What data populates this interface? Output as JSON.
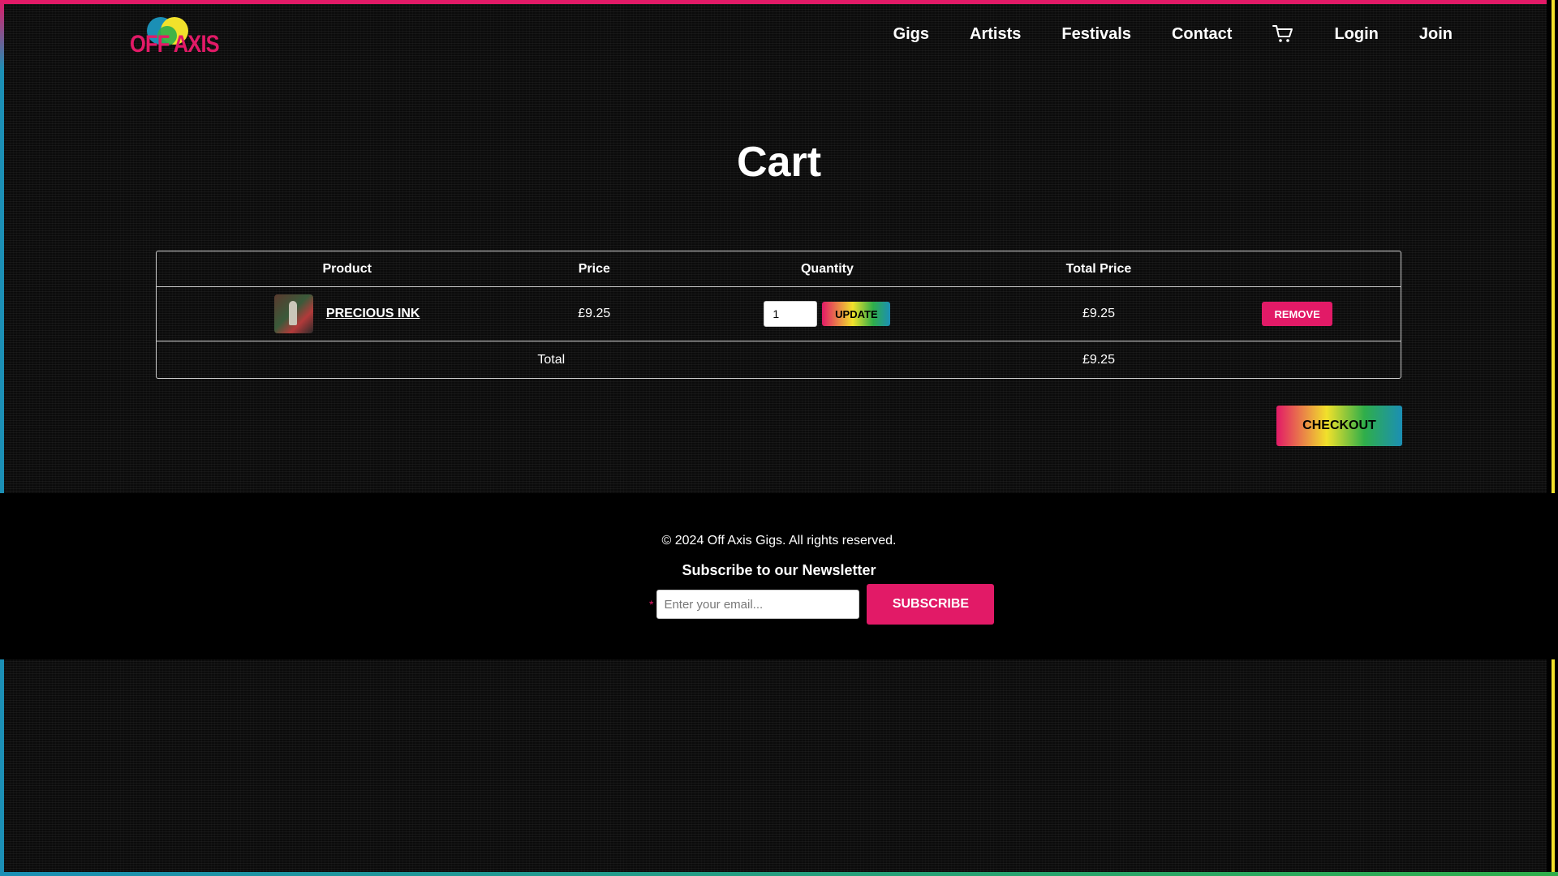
{
  "brand": {
    "logo_text": "OFF AXIS",
    "colors": {
      "pink": "#e21a67",
      "yellow": "#f1e12b",
      "green": "#2fae4a",
      "blue": "#1b8fb5"
    }
  },
  "nav": {
    "items": [
      {
        "label": "Gigs"
      },
      {
        "label": "Artists"
      },
      {
        "label": "Festivals"
      },
      {
        "label": "Contact"
      }
    ],
    "cart_icon": "cart-icon",
    "login": "Login",
    "join": "Join"
  },
  "page": {
    "title": "Cart"
  },
  "cart": {
    "headers": {
      "product": "Product",
      "price": "Price",
      "quantity": "Quantity",
      "total_price": "Total Price"
    },
    "items": [
      {
        "name": "PRECIOUS INK",
        "price": "£9.25",
        "quantity": "1",
        "total_price": "£9.25",
        "update_label": "UPDATE",
        "remove_label": "REMOVE"
      }
    ],
    "total_label": "Total",
    "total_value": "£9.25",
    "checkout_label": "CHECKOUT"
  },
  "footer": {
    "copyright": "© 2024 Off Axis Gigs. All rights reserved.",
    "newsletter_title": "Subscribe to our Newsletter",
    "required_marker": "*",
    "email_placeholder": "Enter your email...",
    "subscribe_label": "SUBSCRIBE"
  }
}
